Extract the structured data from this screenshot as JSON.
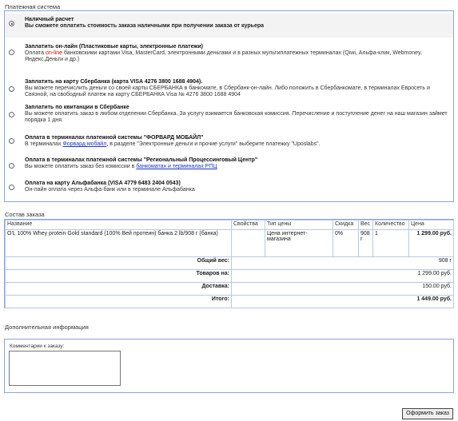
{
  "payment": {
    "section_title": "Платежная система",
    "options": [
      {
        "title": "Наличный расчет",
        "desc": "Вы сможете оплатить стоимость заказа наличными при получении заказа от курьера"
      },
      {
        "title": "Заплатить он-лайн (Пластиковые карты, электронные платежи)",
        "desc_a": "Оплата",
        "desc_online": "on-line",
        "desc_b": "банковскими картами Visa, MasterCard, электронными деньгами и в разных мультиплатежных терминалах (Qiwi, Альфа-клик, Webmoney, Яндекс.Деньги и др.)"
      },
      {
        "title": "Заплатить на карту Сбербанка (карта VISA 4276 3800 1688 4904).",
        "desc": "Вы можете перечислить деньги со своей карты СБЕРБАНКА в банкомате, в Сбербанк-он-лайн. Либо положить в Сбербанкомате, в терминалах Евросеть и Связной, на свободный платеж на карту СБЕРБАНКА Visa № 4276 3800 1688 4904"
      },
      {
        "title": "Заплатить по квитанции в Сбербанке",
        "desc": "Вы можете оплатить заказ в любом отделении Сбербанка. За услугу взимается банковская комиссия. Перечисление и поступление денег на наш магазин займет порядка 1 дня."
      },
      {
        "title": "Оплата в терминалах платежной системы \"ФОРВАРД МОБАЙЛ\"",
        "desc_a": "В терминалах",
        "desc_link": "Форвард мобайл",
        "desc_b": ", в разделе \"Электронные деньги и прочие услуги\" выберите платежку \"Uposlabs\"."
      },
      {
        "title": "Оплата в терминалах платежной системы \"Региональный Процессинговый Центр\"",
        "desc_a": "Вы можете оплатить заказ без комиссии в",
        "desc_link": "банкоматах и терминалах РПЦ"
      },
      {
        "title": "Оплата на карту Альфабанка (VISA 4779 6483 2404 0543)",
        "desc": "Он-лайн оплата через Альфа-банк или в терминале Альфабанка"
      }
    ]
  },
  "order": {
    "section_title": "Состав заказа",
    "headers": [
      "Название",
      "Свойства",
      "Тип цены",
      "Скидка",
      "Вес",
      "Количество",
      "Цена"
    ],
    "item": {
      "name": "O'L 100% Whey protein Gold standard (100% Вей протеин) банка 2 lb/908 г (банка)",
      "props": "",
      "price_type": "Цена интернет-магазина",
      "discount": "0%",
      "weight": "908 г",
      "qty": "1",
      "price": "1 299.00 руб."
    },
    "summary": [
      {
        "label": "Общий вес:",
        "value": "908 г"
      },
      {
        "label": "Товаров на:",
        "value": "1 299.00 руб."
      },
      {
        "label": "Доставка:",
        "value": "150.00 руб."
      },
      {
        "label": "Итого:",
        "value": "1 449.00 руб."
      }
    ]
  },
  "extra": {
    "section_title": "Дополнительная информация",
    "comment_label": "Комментарии к заказу:"
  },
  "submit_label": "Оформить заказ"
}
